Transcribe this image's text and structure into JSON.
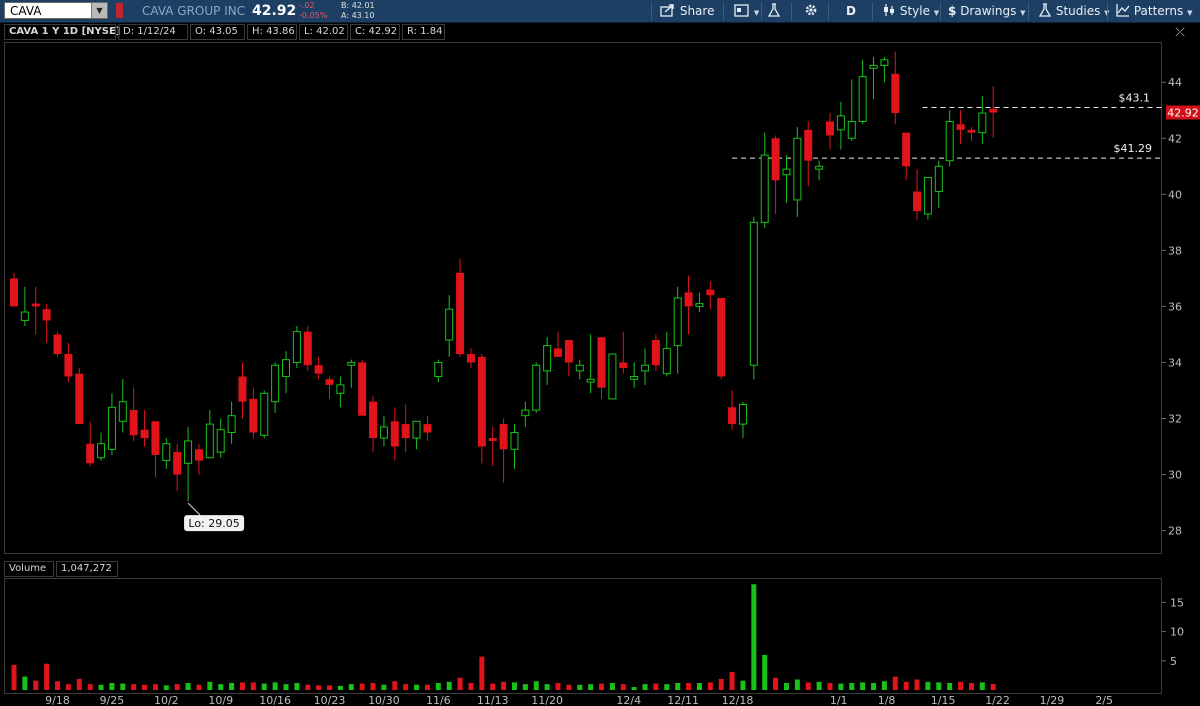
{
  "toolbar": {
    "symbol": "CAVA",
    "company": "CAVA GROUP INC",
    "last": "42.92",
    "change": "-.02",
    "change_pct": "-0.05%",
    "bid": "B: 42.01",
    "ask": "A: 43.10",
    "share_label": "Share",
    "period_label": "D",
    "style_label": "Style",
    "drawings_label": "Drawings",
    "studies_label": "Studies",
    "patterns_label": "Patterns"
  },
  "info": {
    "title": "CAVA 1 Y 1D [NYSE]",
    "date": "D: 1/12/24",
    "open": "O: 43.05",
    "high": "H: 43.86",
    "low": "L: 42.02",
    "close": "C: 42.92",
    "range": "R: 1.84"
  },
  "volume_panel": {
    "label": "Volume",
    "value": "1,047,272"
  },
  "annotations": {
    "low_callout": "Lo: 29.05",
    "level_high_label": "$43.1",
    "level_high": 43.1,
    "level_low_label": "$41.29",
    "level_low": 41.29,
    "last_price_tag": "42.92"
  },
  "colors": {
    "up": "#19c219",
    "down": "#e1141c",
    "toolbar": "#1c3f63",
    "last_tag": "#d01018"
  },
  "chart_data": {
    "type": "candlestick",
    "ylim": [
      27.2,
      45.4
    ],
    "price_ticks": [
      28,
      30,
      32,
      34,
      36,
      38,
      40,
      42,
      44
    ],
    "volume_ylim": [
      0,
      19
    ],
    "volume_ticks": [
      5,
      10,
      15
    ],
    "x_ticks": [
      {
        "label": "9/18",
        "i": 4
      },
      {
        "label": "9/25",
        "i": 9
      },
      {
        "label": "10/2",
        "i": 14
      },
      {
        "label": "10/9",
        "i": 19
      },
      {
        "label": "10/16",
        "i": 24
      },
      {
        "label": "10/23",
        "i": 29
      },
      {
        "label": "10/30",
        "i": 34
      },
      {
        "label": "11/6",
        "i": 39
      },
      {
        "label": "11/13",
        "i": 44
      },
      {
        "label": "11/20",
        "i": 49
      },
      {
        "label": "12/4",
        "i": 56.5
      },
      {
        "label": "12/11",
        "i": 61.5
      },
      {
        "label": "12/18",
        "i": 66.5
      },
      {
        "label": "1/1",
        "i": 75.8
      },
      {
        "label": "1/8",
        "i": 80.2
      },
      {
        "label": "1/15",
        "i": 85.4
      },
      {
        "label": "1/22",
        "i": 90.4
      },
      {
        "label": "1/29",
        "i": 95.4
      },
      {
        "label": "2/5",
        "i": 100.2
      }
    ],
    "candles": [
      {
        "o": 37.0,
        "h": 37.2,
        "l": 36.0,
        "c": 36.0,
        "v": 4.3
      },
      {
        "o": 35.5,
        "h": 36.7,
        "l": 35.3,
        "c": 35.8,
        "v": 2.3
      },
      {
        "o": 36.1,
        "h": 36.7,
        "l": 35.0,
        "c": 36.0,
        "v": 1.6
      },
      {
        "o": 35.9,
        "h": 36.1,
        "l": 34.7,
        "c": 35.5,
        "v": 4.5
      },
      {
        "o": 35.0,
        "h": 35.1,
        "l": 34.2,
        "c": 34.3,
        "v": 1.5
      },
      {
        "o": 34.3,
        "h": 34.7,
        "l": 33.3,
        "c": 33.5,
        "v": 1.0
      },
      {
        "o": 33.6,
        "h": 33.8,
        "l": 31.8,
        "c": 31.8,
        "v": 1.9
      },
      {
        "o": 31.1,
        "h": 31.9,
        "l": 30.3,
        "c": 30.4,
        "v": 1.0
      },
      {
        "o": 30.6,
        "h": 31.5,
        "l": 30.5,
        "c": 31.1,
        "v": 0.9
      },
      {
        "o": 30.9,
        "h": 32.9,
        "l": 30.7,
        "c": 32.4,
        "v": 1.2
      },
      {
        "o": 31.9,
        "h": 33.4,
        "l": 31.5,
        "c": 32.6,
        "v": 1.1
      },
      {
        "o": 32.3,
        "h": 33.1,
        "l": 31.2,
        "c": 31.4,
        "v": 1.0
      },
      {
        "o": 31.6,
        "h": 32.3,
        "l": 31.0,
        "c": 31.3,
        "v": 0.9
      },
      {
        "o": 31.9,
        "h": 31.9,
        "l": 29.9,
        "c": 30.7,
        "v": 1.0
      },
      {
        "o": 30.5,
        "h": 31.3,
        "l": 30.2,
        "c": 31.1,
        "v": 0.8
      },
      {
        "o": 30.8,
        "h": 31.1,
        "l": 29.4,
        "c": 30.0,
        "v": 1.0
      },
      {
        "o": 30.4,
        "h": 31.7,
        "l": 29.05,
        "c": 31.2,
        "v": 1.2
      },
      {
        "o": 30.9,
        "h": 31.1,
        "l": 30.0,
        "c": 30.5,
        "v": 0.9
      },
      {
        "o": 30.6,
        "h": 32.3,
        "l": 30.6,
        "c": 31.8,
        "v": 1.4
      },
      {
        "o": 30.8,
        "h": 32.0,
        "l": 30.6,
        "c": 31.6,
        "v": 1.0
      },
      {
        "o": 31.5,
        "h": 32.6,
        "l": 31.1,
        "c": 32.1,
        "v": 1.2
      },
      {
        "o": 33.5,
        "h": 34.0,
        "l": 32.0,
        "c": 32.6,
        "v": 1.3
      },
      {
        "o": 32.7,
        "h": 33.1,
        "l": 31.3,
        "c": 31.5,
        "v": 1.3
      },
      {
        "o": 31.4,
        "h": 33.0,
        "l": 31.3,
        "c": 32.9,
        "v": 1.1
      },
      {
        "o": 32.6,
        "h": 34.0,
        "l": 32.2,
        "c": 33.9,
        "v": 1.3
      },
      {
        "o": 33.5,
        "h": 34.4,
        "l": 32.9,
        "c": 34.1,
        "v": 1.0
      },
      {
        "o": 34.0,
        "h": 35.3,
        "l": 33.8,
        "c": 35.1,
        "v": 1.2
      },
      {
        "o": 35.1,
        "h": 35.3,
        "l": 33.7,
        "c": 33.9,
        "v": 0.9
      },
      {
        "o": 33.9,
        "h": 34.2,
        "l": 33.4,
        "c": 33.6,
        "v": 0.8
      },
      {
        "o": 33.4,
        "h": 33.5,
        "l": 32.7,
        "c": 33.2,
        "v": 0.8
      },
      {
        "o": 32.9,
        "h": 33.5,
        "l": 32.4,
        "c": 33.2,
        "v": 0.7
      },
      {
        "o": 33.9,
        "h": 34.1,
        "l": 33.1,
        "c": 34.0,
        "v": 1.0
      },
      {
        "o": 34.0,
        "h": 34.1,
        "l": 32.1,
        "c": 32.1,
        "v": 1.1
      },
      {
        "o": 32.6,
        "h": 32.8,
        "l": 30.8,
        "c": 31.3,
        "v": 1.2
      },
      {
        "o": 31.3,
        "h": 32.1,
        "l": 31.0,
        "c": 31.7,
        "v": 0.9
      },
      {
        "o": 31.9,
        "h": 32.4,
        "l": 30.5,
        "c": 31.0,
        "v": 1.5
      },
      {
        "o": 31.8,
        "h": 32.5,
        "l": 30.8,
        "c": 31.3,
        "v": 1.0
      },
      {
        "o": 31.3,
        "h": 31.9,
        "l": 30.9,
        "c": 31.9,
        "v": 0.9
      },
      {
        "o": 31.8,
        "h": 32.1,
        "l": 31.2,
        "c": 31.5,
        "v": 0.9
      },
      {
        "o": 33.5,
        "h": 34.1,
        "l": 33.3,
        "c": 34.0,
        "v": 1.2
      },
      {
        "o": 34.8,
        "h": 36.4,
        "l": 34.2,
        "c": 35.9,
        "v": 1.4
      },
      {
        "o": 37.2,
        "h": 37.7,
        "l": 34.2,
        "c": 34.3,
        "v": 2.1
      },
      {
        "o": 34.3,
        "h": 34.5,
        "l": 33.8,
        "c": 34.0,
        "v": 1.2
      },
      {
        "o": 34.2,
        "h": 34.3,
        "l": 30.4,
        "c": 31.0,
        "v": 5.7
      },
      {
        "o": 31.3,
        "h": 31.7,
        "l": 30.3,
        "c": 31.2,
        "v": 1.1
      },
      {
        "o": 31.8,
        "h": 32.0,
        "l": 29.7,
        "c": 30.9,
        "v": 1.4
      },
      {
        "o": 30.9,
        "h": 31.8,
        "l": 30.2,
        "c": 31.5,
        "v": 1.3
      },
      {
        "o": 32.1,
        "h": 32.6,
        "l": 31.7,
        "c": 32.3,
        "v": 1.0
      },
      {
        "o": 32.3,
        "h": 34.0,
        "l": 32.2,
        "c": 33.9,
        "v": 1.5
      },
      {
        "o": 33.7,
        "h": 34.9,
        "l": 33.2,
        "c": 34.6,
        "v": 1.0
      },
      {
        "o": 34.5,
        "h": 35.1,
        "l": 34.2,
        "c": 34.2,
        "v": 1.2
      },
      {
        "o": 34.8,
        "h": 34.8,
        "l": 33.5,
        "c": 34.0,
        "v": 0.9
      },
      {
        "o": 33.7,
        "h": 34.1,
        "l": 33.4,
        "c": 33.9,
        "v": 0.9
      },
      {
        "o": 33.3,
        "h": 35.0,
        "l": 32.9,
        "c": 33.4,
        "v": 1.0
      },
      {
        "o": 34.9,
        "h": 34.9,
        "l": 32.7,
        "c": 33.1,
        "v": 1.1
      },
      {
        "o": 32.7,
        "h": 34.3,
        "l": 32.7,
        "c": 34.3,
        "v": 1.2
      },
      {
        "o": 34.0,
        "h": 35.1,
        "l": 33.6,
        "c": 33.8,
        "v": 1.0
      },
      {
        "o": 33.4,
        "h": 34.0,
        "l": 33.1,
        "c": 33.5,
        "v": 0.5
      },
      {
        "o": 33.7,
        "h": 34.5,
        "l": 33.2,
        "c": 33.9,
        "v": 1.0
      },
      {
        "o": 34.8,
        "h": 35.0,
        "l": 33.7,
        "c": 33.9,
        "v": 1.1
      },
      {
        "o": 33.6,
        "h": 35.1,
        "l": 33.5,
        "c": 34.5,
        "v": 1.0
      },
      {
        "o": 34.6,
        "h": 36.7,
        "l": 33.6,
        "c": 36.3,
        "v": 1.2
      },
      {
        "o": 36.5,
        "h": 37.1,
        "l": 35.0,
        "c": 36.0,
        "v": 1.2
      },
      {
        "o": 36.0,
        "h": 36.5,
        "l": 35.8,
        "c": 36.1,
        "v": 1.2
      },
      {
        "o": 36.6,
        "h": 36.9,
        "l": 35.9,
        "c": 36.4,
        "v": 1.3
      },
      {
        "o": 36.3,
        "h": 36.3,
        "l": 33.4,
        "c": 33.5,
        "v": 1.9
      },
      {
        "o": 32.4,
        "h": 33.0,
        "l": 31.6,
        "c": 31.8,
        "v": 3.1
      },
      {
        "o": 31.8,
        "h": 32.6,
        "l": 31.3,
        "c": 32.5,
        "v": 1.6
      },
      {
        "o": 33.9,
        "h": 39.2,
        "l": 33.4,
        "c": 39.0,
        "v": 18.1
      },
      {
        "o": 39.0,
        "h": 42.2,
        "l": 38.8,
        "c": 41.4,
        "v": 6.0
      },
      {
        "o": 42.0,
        "h": 42.1,
        "l": 39.3,
        "c": 40.5,
        "v": 2.1
      },
      {
        "o": 40.7,
        "h": 41.4,
        "l": 39.7,
        "c": 40.9,
        "v": 1.2
      },
      {
        "o": 39.8,
        "h": 42.4,
        "l": 39.2,
        "c": 42.0,
        "v": 1.8
      },
      {
        "o": 42.3,
        "h": 42.6,
        "l": 40.3,
        "c": 41.2,
        "v": 1.3
      },
      {
        "o": 40.9,
        "h": 41.2,
        "l": 40.5,
        "c": 41.0,
        "v": 1.4
      },
      {
        "o": 42.6,
        "h": 42.9,
        "l": 41.6,
        "c": 42.1,
        "v": 1.2
      },
      {
        "o": 42.3,
        "h": 43.3,
        "l": 41.6,
        "c": 42.8,
        "v": 1.1
      },
      {
        "o": 42.0,
        "h": 44.1,
        "l": 41.9,
        "c": 42.6,
        "v": 1.2
      },
      {
        "o": 42.6,
        "h": 44.8,
        "l": 42.5,
        "c": 44.2,
        "v": 1.3
      },
      {
        "o": 44.5,
        "h": 44.9,
        "l": 43.4,
        "c": 44.6,
        "v": 1.2
      },
      {
        "o": 44.6,
        "h": 44.9,
        "l": 44.0,
        "c": 44.8,
        "v": 1.5
      },
      {
        "o": 44.3,
        "h": 45.1,
        "l": 42.5,
        "c": 42.9,
        "v": 2.3
      },
      {
        "o": 42.2,
        "h": 42.2,
        "l": 40.5,
        "c": 41.0,
        "v": 1.4
      },
      {
        "o": 40.1,
        "h": 40.9,
        "l": 39.1,
        "c": 39.4,
        "v": 1.8
      },
      {
        "o": 39.3,
        "h": 40.5,
        "l": 39.1,
        "c": 40.6,
        "v": 1.4
      },
      {
        "o": 40.1,
        "h": 41.2,
        "l": 39.5,
        "c": 41.0,
        "v": 1.3
      },
      {
        "o": 41.2,
        "h": 43.0,
        "l": 41.0,
        "c": 42.6,
        "v": 1.2
      },
      {
        "o": 42.5,
        "h": 43.0,
        "l": 41.8,
        "c": 42.3,
        "v": 1.4
      },
      {
        "o": 42.3,
        "h": 42.4,
        "l": 41.9,
        "c": 42.2,
        "v": 1.2
      },
      {
        "o": 42.2,
        "h": 43.5,
        "l": 41.8,
        "c": 42.9,
        "v": 1.3
      },
      {
        "o": 43.05,
        "h": 43.86,
        "l": 42.02,
        "c": 42.92,
        "v": 1.05
      }
    ]
  }
}
